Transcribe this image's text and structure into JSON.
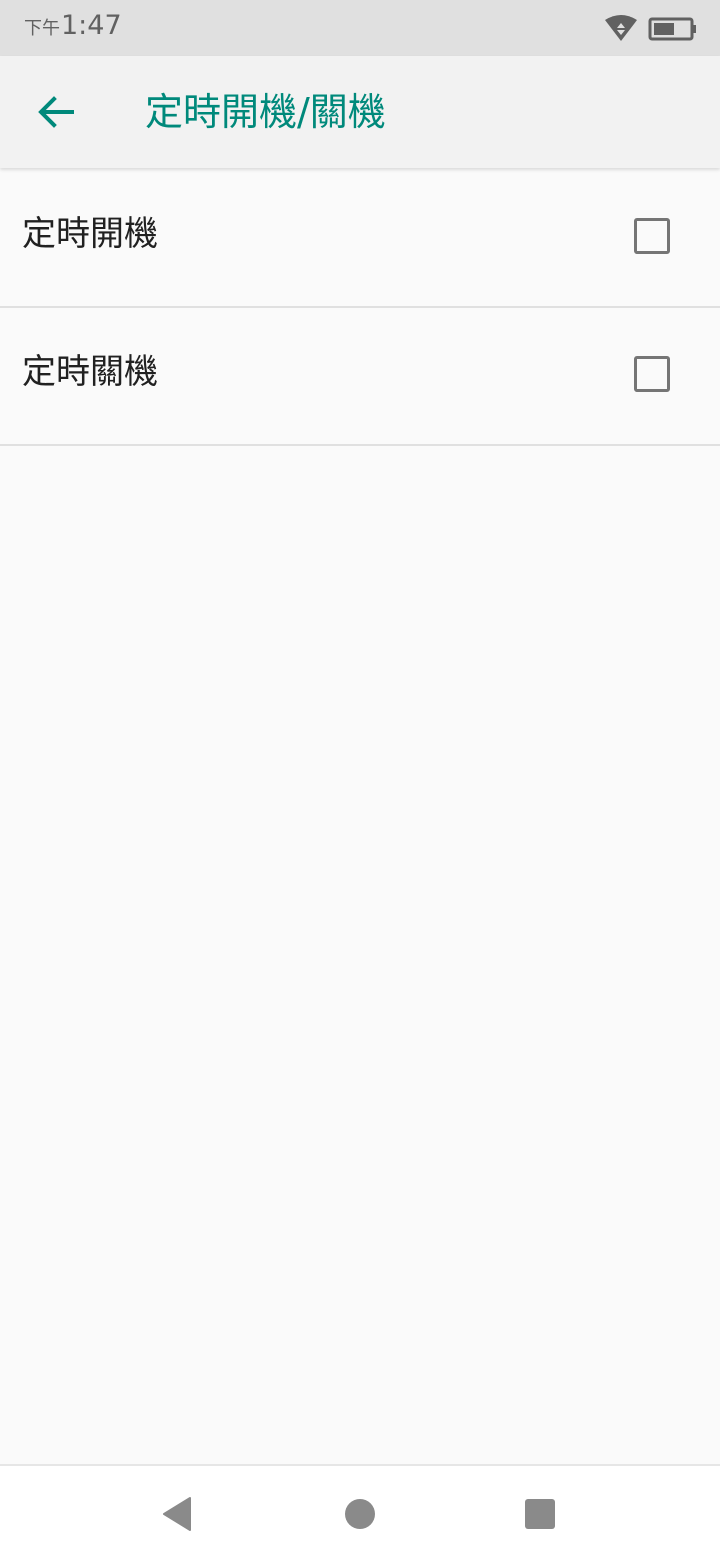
{
  "status_bar": {
    "ampm": "下午",
    "time": "1:47",
    "icons": [
      "wifi-icon",
      "battery-icon"
    ]
  },
  "app_bar": {
    "back_icon": "arrow-left-icon",
    "title": "定時開機/關機"
  },
  "preferences": [
    {
      "label": "定時開機",
      "checked": false
    },
    {
      "label": "定時關機",
      "checked": false
    }
  ],
  "nav_bar": {
    "icons": [
      "nav-back-icon",
      "nav-home-icon",
      "nav-recents-icon"
    ]
  },
  "colors": {
    "accent": "#00897b",
    "status_bar_bg": "#e0e0e0",
    "app_bar_bg": "#f2f2f2",
    "background": "#fafafa",
    "text_primary": "#212121",
    "checkbox_border": "#757575",
    "nav_icon": "#8a8a8a"
  }
}
